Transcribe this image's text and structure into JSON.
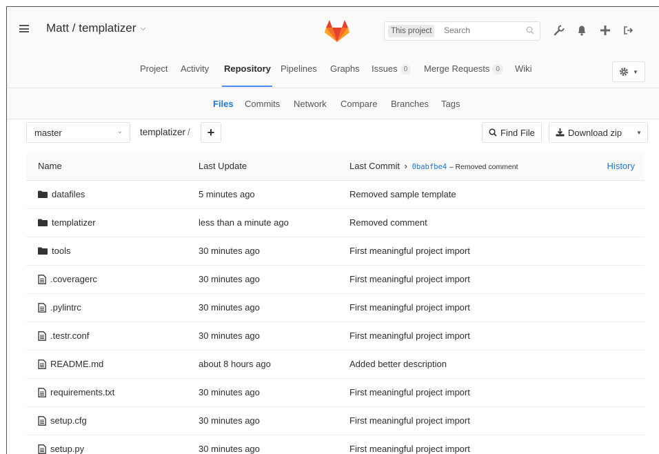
{
  "header": {
    "project_title": "Matt / templatizer",
    "search_scope": "This project",
    "search_placeholder": "Search",
    "accent_color": "#e24329"
  },
  "nav": {
    "items": [
      {
        "label": "Project"
      },
      {
        "label": "Activity"
      },
      {
        "label": "Repository"
      },
      {
        "label": "Pipelines"
      },
      {
        "label": "Graphs"
      },
      {
        "label": "Issues",
        "count": "0"
      },
      {
        "label": "Merge Requests",
        "count": "0"
      },
      {
        "label": "Wiki"
      }
    ],
    "active": "Repository"
  },
  "subnav": {
    "items": [
      "Files",
      "Commits",
      "Network",
      "Compare",
      "Branches",
      "Tags"
    ],
    "active": "Files"
  },
  "toolbar": {
    "branch": "master",
    "path": "templatizer",
    "path_sep": "/",
    "find_file": "Find File",
    "download": "Download zip"
  },
  "table": {
    "headers": {
      "name": "Name",
      "last_update": "Last Update",
      "last_commit": "Last Commit",
      "commit_sha": "0babfbe4",
      "commit_msg": "– Removed comment",
      "history": "History"
    },
    "rows": [
      {
        "type": "folder",
        "name": "datafiles",
        "updated": "5 minutes ago",
        "commit": "Removed sample template"
      },
      {
        "type": "folder",
        "name": "templatizer",
        "updated": "less than a minute ago",
        "commit": "Removed comment"
      },
      {
        "type": "folder",
        "name": "tools",
        "updated": "30 minutes ago",
        "commit": "First meaningful project import"
      },
      {
        "type": "file",
        "name": ".coveragerc",
        "updated": "30 minutes ago",
        "commit": "First meaningful project import"
      },
      {
        "type": "file",
        "name": ".pylintrc",
        "updated": "30 minutes ago",
        "commit": "First meaningful project import"
      },
      {
        "type": "file",
        "name": ".testr.conf",
        "updated": "30 minutes ago",
        "commit": "First meaningful project import"
      },
      {
        "type": "file",
        "name": "README.md",
        "updated": "about 8 hours ago",
        "commit": "Added better description"
      },
      {
        "type": "file",
        "name": "requirements.txt",
        "updated": "30 minutes ago",
        "commit": "First meaningful project import"
      },
      {
        "type": "file",
        "name": "setup.cfg",
        "updated": "30 minutes ago",
        "commit": "First meaningful project import"
      },
      {
        "type": "file",
        "name": "setup.py",
        "updated": "30 minutes ago",
        "commit": "First meaningful project import"
      }
    ]
  }
}
